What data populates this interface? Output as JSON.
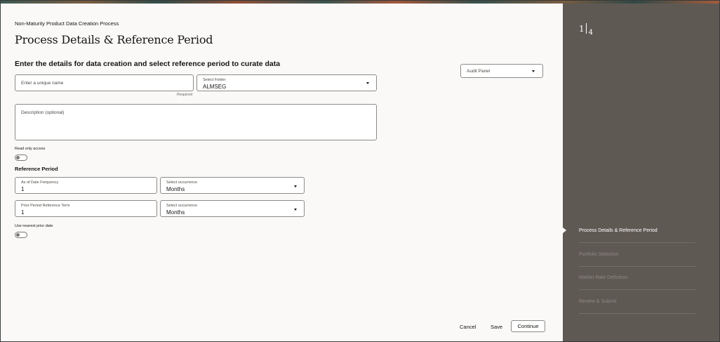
{
  "header": {
    "eyebrow": "Non-Maturity Product Data Creation Process",
    "title": "Process Details & Reference Period",
    "subtitle": "Enter the details for data creation and select reference period to curate data"
  },
  "form": {
    "name_placeholder": "Enter a unique name",
    "name_help": "Required",
    "folder_label": "Select Folder",
    "folder_value": "ALMSEG",
    "description_placeholder": "Description (optional)",
    "read_only_label": "Read only access",
    "read_only_on": false
  },
  "reference_period": {
    "heading": "Reference Period",
    "as_of_label": "As of Date Frequency",
    "as_of_value": "1",
    "occurrence_label_1": "Select occurrence",
    "occurrence_value_1": "Months",
    "prior_label": "Prior Period Reference Term",
    "prior_value": "1",
    "occurrence_label_2": "Select occurrence",
    "occurrence_value_2": "Months",
    "nearest_label": "Use nearest prior date",
    "nearest_on": false
  },
  "audit_panel": {
    "placeholder": "Audit Panel"
  },
  "footer": {
    "cancel": "Cancel",
    "save": "Save",
    "continue": "Continue"
  },
  "train": {
    "current": "1",
    "total": "4",
    "steps": [
      {
        "label": "Process Details & Reference Period",
        "state": "active"
      },
      {
        "label": "Portfolio Selection",
        "state": "inactive"
      },
      {
        "label": "Market Rate Definition",
        "state": "inactive"
      },
      {
        "label": "Review & Submit",
        "state": "inactive"
      }
    ]
  },
  "colors": {
    "side_panel": "#5f5954",
    "main_bg": "#faf9f8",
    "accent_text": "#161513"
  }
}
